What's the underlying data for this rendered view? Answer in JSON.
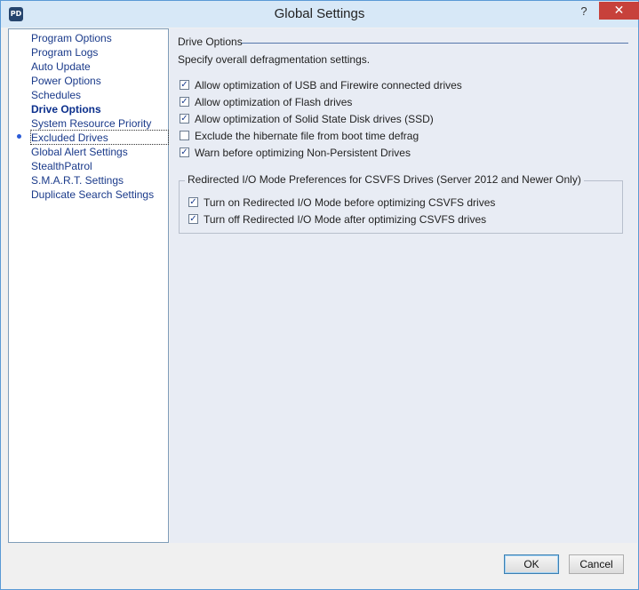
{
  "window": {
    "title": "Global Settings",
    "icon_text": "PD",
    "help_label": "?",
    "close_label": "✕"
  },
  "nav": {
    "items": [
      {
        "label": "Program Options"
      },
      {
        "label": "Program Logs"
      },
      {
        "label": "Auto Update"
      },
      {
        "label": "Power Options"
      },
      {
        "label": "Schedules"
      },
      {
        "label": "Drive Options",
        "selected": true
      },
      {
        "label": "System Resource Priority"
      },
      {
        "label": "Excluded Drives"
      },
      {
        "label": "Global Alert Settings"
      },
      {
        "label": "StealthPatrol"
      },
      {
        "label": "S.M.A.R.T. Settings"
      },
      {
        "label": "Duplicate Search Settings"
      }
    ]
  },
  "panel": {
    "section_title": "Drive Options",
    "description": "Specify overall defragmentation settings.",
    "options": [
      {
        "label": "Allow optimization of USB and Firewire connected drives",
        "checked": true
      },
      {
        "label": "Allow optimization of Flash drives",
        "checked": true
      },
      {
        "label": "Allow optimization of Solid State Disk drives (SSD)",
        "checked": true
      },
      {
        "label": "Exclude the hibernate file from boot time defrag",
        "checked": false
      },
      {
        "label": "Warn before optimizing Non-Persistent Drives",
        "checked": true
      }
    ],
    "group": {
      "title": "Redirected I/O Mode Preferences for CSVFS Drives (Server 2012 and Newer Only)",
      "options": [
        {
          "label": "Turn on Redirected I/O Mode before optimizing CSVFS drives",
          "checked": true
        },
        {
          "label": "Turn off Redirected I/O Mode after optimizing CSVFS drives",
          "checked": true
        }
      ]
    }
  },
  "footer": {
    "ok_label": "OK",
    "cancel_label": "Cancel"
  },
  "colors": {
    "title_bar": "#d7e8f7",
    "close_button": "#c7413b",
    "panel_bg": "#e8ecf4",
    "nav_link": "#1a3a8a"
  }
}
